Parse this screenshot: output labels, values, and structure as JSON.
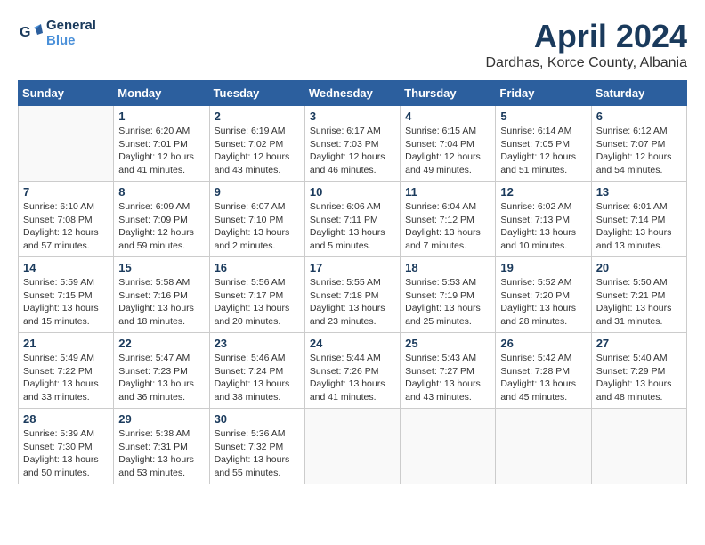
{
  "logo": {
    "line1": "General",
    "line2": "Blue"
  },
  "title": "April 2024",
  "location": "Dardhas, Korce County, Albania",
  "weekdays": [
    "Sunday",
    "Monday",
    "Tuesday",
    "Wednesday",
    "Thursday",
    "Friday",
    "Saturday"
  ],
  "weeks": [
    [
      {
        "day": "",
        "info": ""
      },
      {
        "day": "1",
        "info": "Sunrise: 6:20 AM\nSunset: 7:01 PM\nDaylight: 12 hours\nand 41 minutes."
      },
      {
        "day": "2",
        "info": "Sunrise: 6:19 AM\nSunset: 7:02 PM\nDaylight: 12 hours\nand 43 minutes."
      },
      {
        "day": "3",
        "info": "Sunrise: 6:17 AM\nSunset: 7:03 PM\nDaylight: 12 hours\nand 46 minutes."
      },
      {
        "day": "4",
        "info": "Sunrise: 6:15 AM\nSunset: 7:04 PM\nDaylight: 12 hours\nand 49 minutes."
      },
      {
        "day": "5",
        "info": "Sunrise: 6:14 AM\nSunset: 7:05 PM\nDaylight: 12 hours\nand 51 minutes."
      },
      {
        "day": "6",
        "info": "Sunrise: 6:12 AM\nSunset: 7:07 PM\nDaylight: 12 hours\nand 54 minutes."
      }
    ],
    [
      {
        "day": "7",
        "info": "Sunrise: 6:10 AM\nSunset: 7:08 PM\nDaylight: 12 hours\nand 57 minutes."
      },
      {
        "day": "8",
        "info": "Sunrise: 6:09 AM\nSunset: 7:09 PM\nDaylight: 12 hours\nand 59 minutes."
      },
      {
        "day": "9",
        "info": "Sunrise: 6:07 AM\nSunset: 7:10 PM\nDaylight: 13 hours\nand 2 minutes."
      },
      {
        "day": "10",
        "info": "Sunrise: 6:06 AM\nSunset: 7:11 PM\nDaylight: 13 hours\nand 5 minutes."
      },
      {
        "day": "11",
        "info": "Sunrise: 6:04 AM\nSunset: 7:12 PM\nDaylight: 13 hours\nand 7 minutes."
      },
      {
        "day": "12",
        "info": "Sunrise: 6:02 AM\nSunset: 7:13 PM\nDaylight: 13 hours\nand 10 minutes."
      },
      {
        "day": "13",
        "info": "Sunrise: 6:01 AM\nSunset: 7:14 PM\nDaylight: 13 hours\nand 13 minutes."
      }
    ],
    [
      {
        "day": "14",
        "info": "Sunrise: 5:59 AM\nSunset: 7:15 PM\nDaylight: 13 hours\nand 15 minutes."
      },
      {
        "day": "15",
        "info": "Sunrise: 5:58 AM\nSunset: 7:16 PM\nDaylight: 13 hours\nand 18 minutes."
      },
      {
        "day": "16",
        "info": "Sunrise: 5:56 AM\nSunset: 7:17 PM\nDaylight: 13 hours\nand 20 minutes."
      },
      {
        "day": "17",
        "info": "Sunrise: 5:55 AM\nSunset: 7:18 PM\nDaylight: 13 hours\nand 23 minutes."
      },
      {
        "day": "18",
        "info": "Sunrise: 5:53 AM\nSunset: 7:19 PM\nDaylight: 13 hours\nand 25 minutes."
      },
      {
        "day": "19",
        "info": "Sunrise: 5:52 AM\nSunset: 7:20 PM\nDaylight: 13 hours\nand 28 minutes."
      },
      {
        "day": "20",
        "info": "Sunrise: 5:50 AM\nSunset: 7:21 PM\nDaylight: 13 hours\nand 31 minutes."
      }
    ],
    [
      {
        "day": "21",
        "info": "Sunrise: 5:49 AM\nSunset: 7:22 PM\nDaylight: 13 hours\nand 33 minutes."
      },
      {
        "day": "22",
        "info": "Sunrise: 5:47 AM\nSunset: 7:23 PM\nDaylight: 13 hours\nand 36 minutes."
      },
      {
        "day": "23",
        "info": "Sunrise: 5:46 AM\nSunset: 7:24 PM\nDaylight: 13 hours\nand 38 minutes."
      },
      {
        "day": "24",
        "info": "Sunrise: 5:44 AM\nSunset: 7:26 PM\nDaylight: 13 hours\nand 41 minutes."
      },
      {
        "day": "25",
        "info": "Sunrise: 5:43 AM\nSunset: 7:27 PM\nDaylight: 13 hours\nand 43 minutes."
      },
      {
        "day": "26",
        "info": "Sunrise: 5:42 AM\nSunset: 7:28 PM\nDaylight: 13 hours\nand 45 minutes."
      },
      {
        "day": "27",
        "info": "Sunrise: 5:40 AM\nSunset: 7:29 PM\nDaylight: 13 hours\nand 48 minutes."
      }
    ],
    [
      {
        "day": "28",
        "info": "Sunrise: 5:39 AM\nSunset: 7:30 PM\nDaylight: 13 hours\nand 50 minutes."
      },
      {
        "day": "29",
        "info": "Sunrise: 5:38 AM\nSunset: 7:31 PM\nDaylight: 13 hours\nand 53 minutes."
      },
      {
        "day": "30",
        "info": "Sunrise: 5:36 AM\nSunset: 7:32 PM\nDaylight: 13 hours\nand 55 minutes."
      },
      {
        "day": "",
        "info": ""
      },
      {
        "day": "",
        "info": ""
      },
      {
        "day": "",
        "info": ""
      },
      {
        "day": "",
        "info": ""
      }
    ]
  ]
}
